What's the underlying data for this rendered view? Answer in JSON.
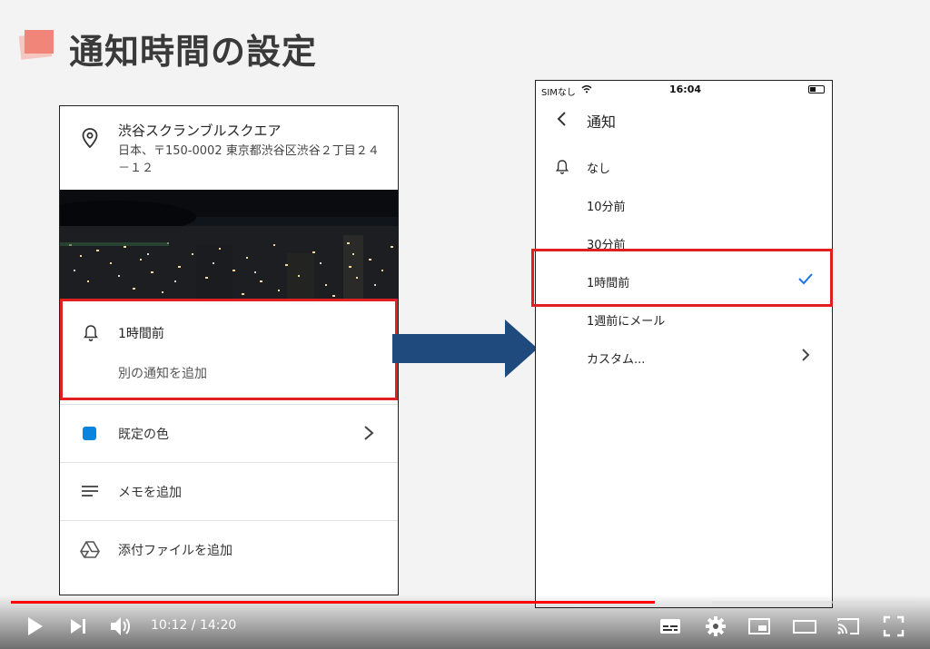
{
  "slide": {
    "title": "通知時間の設定"
  },
  "left_phone": {
    "location_name": "渋谷スクランブルスクエア",
    "location_address": "日本、〒150-0002 東京都渋谷区渋谷２丁目２４－１２",
    "notification_label": "1時間前",
    "add_notification": "別の通知を追加",
    "default_color_label": "既定の色",
    "memo_label": "メモを追加",
    "attachment_label": "添付ファイルを追加",
    "color_swatch": "#0b84e0"
  },
  "right_phone": {
    "status": {
      "carrier": "SIMなし",
      "time": "16:04"
    },
    "title": "通知",
    "options": [
      {
        "label": "なし",
        "selected": false
      },
      {
        "label": "10分前",
        "selected": false
      },
      {
        "label": "30分前",
        "selected": false
      },
      {
        "label": "1時間前",
        "selected": true
      },
      {
        "label": "1週前にメール",
        "selected": false
      },
      {
        "label": "カスタム...",
        "selected": false
      }
    ]
  },
  "player": {
    "current_time": "10:12",
    "duration": "14:20",
    "time_display": "10:12 / 14:20",
    "progress_fraction": 0.712,
    "buffered_fraction": 0.775
  },
  "colors": {
    "highlight_red": "#e02020",
    "arrow_blue": "#1e4a7e",
    "check_blue": "#1a73e8",
    "progress_red": "#ff0000"
  }
}
